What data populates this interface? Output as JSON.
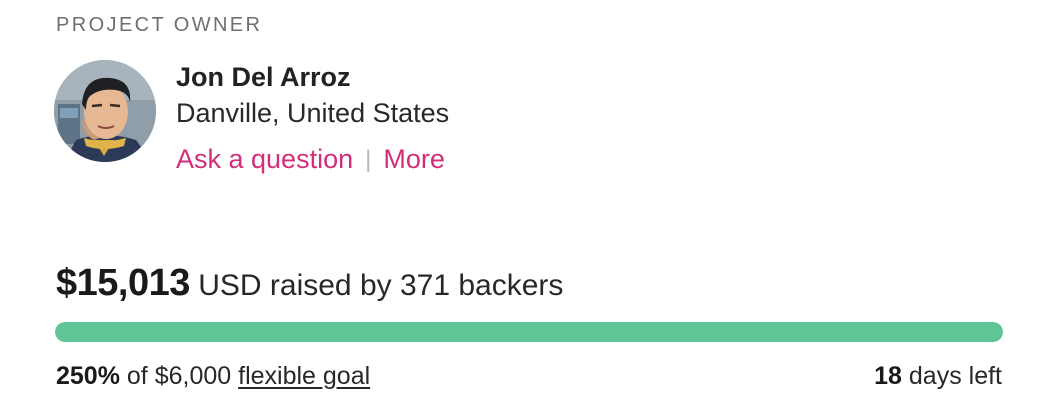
{
  "owner_section": {
    "label": "PROJECT OWNER",
    "name": "Jon Del Arroz",
    "location": "Danville, United States",
    "ask_link": "Ask a question",
    "separator": "|",
    "more_link": "More",
    "link_color": "#d22e79"
  },
  "funding": {
    "amount": "$15,013",
    "raised_text": "USD raised by 371 backers",
    "progress_percent": 100,
    "progress_color": "#5fc496",
    "percent": "250%",
    "of_text": "of $6,000",
    "goal_link": "flexible goal",
    "days": "18",
    "days_text": "days left"
  }
}
